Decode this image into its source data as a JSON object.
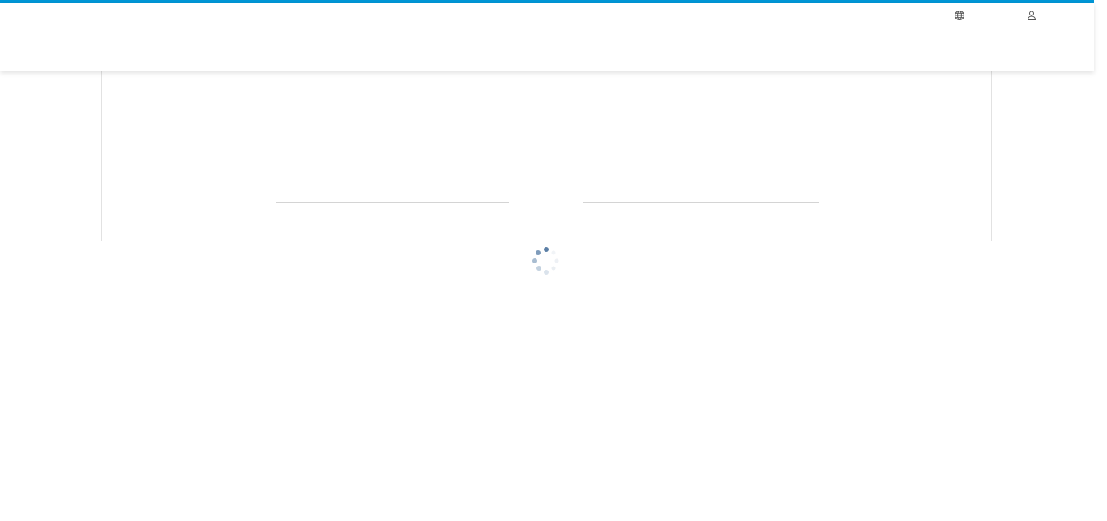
{
  "header": {
    "accent_color": "#0096d6",
    "locale_icon": "globe-icon",
    "locale_label": "",
    "user_icon": "user-icon",
    "signin_label": ""
  },
  "main": {
    "loading_indicator": "spinner-icon",
    "loading_text": ""
  }
}
